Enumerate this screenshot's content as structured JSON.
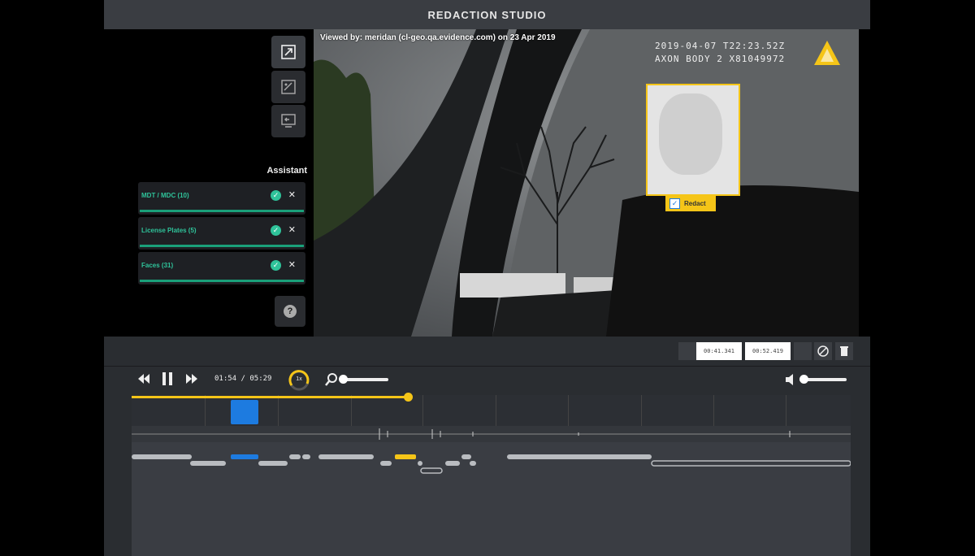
{
  "app": {
    "title": "REDACTION STUDIO"
  },
  "assistant": {
    "heading": "Assistant",
    "items": [
      {
        "label": "MDT / MDC (10)"
      },
      {
        "label": "License Plates (5)"
      },
      {
        "label": "Faces (31)"
      }
    ]
  },
  "video": {
    "watermark": "Viewed by: meridan (cl-geo.qa.evidence.com) on 23 Apr 2019",
    "timestamp": "2019-04-07 T22:23.52Z",
    "device": "AXON BODY 2 X81049972",
    "redaction_label": "Redact"
  },
  "clip": {
    "start": "00:41.341",
    "end": "00:52.419"
  },
  "playback": {
    "current": "01:54",
    "sep": "/",
    "total": "05:29",
    "speed": "1x",
    "progress": 0.384
  },
  "colors": {
    "accent": "#f5c518",
    "assistant_green": "#2fc39a",
    "selection_blue": "#1d7be0"
  },
  "icons": [
    "popout-icon",
    "image-icon",
    "export-icon",
    "help-icon",
    "rewind-icon",
    "pause-icon",
    "forward-icon",
    "zoom-icon",
    "volume-icon",
    "no-icon",
    "trash-icon"
  ]
}
